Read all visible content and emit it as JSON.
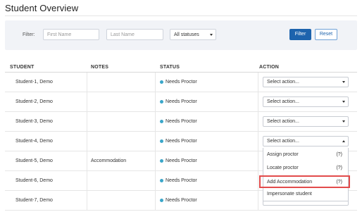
{
  "page": {
    "title": "Student Overview"
  },
  "filter": {
    "label": "Filter:",
    "first_name_placeholder": "First Name",
    "last_name_placeholder": "Last Name",
    "status_selected": "All statuses",
    "filter_button": "Filter",
    "reset_button": "Reset"
  },
  "table": {
    "headers": {
      "student": "STUDENT",
      "notes": "NOTES",
      "status": "STATUS",
      "action": "ACTION"
    },
    "rows": [
      {
        "student": "Student-1, Demo",
        "notes": "",
        "status": "Needs Proctor",
        "action": "Select action..."
      },
      {
        "student": "Student-2, Demo",
        "notes": "",
        "status": "Needs Proctor",
        "action": "Select action..."
      },
      {
        "student": "Student-3, Demo",
        "notes": "",
        "status": "Needs Proctor",
        "action": "Select action..."
      },
      {
        "student": "Student-4, Demo",
        "notes": "",
        "status": "Needs Proctor",
        "action": "Select action..."
      },
      {
        "student": "Student-5, Demo",
        "notes": "Accommodation",
        "status": "Needs Proctor",
        "action": ""
      },
      {
        "student": "Student-6, Demo",
        "notes": "",
        "status": "Needs Proctor",
        "action": ""
      },
      {
        "student": "Student-7, Demo",
        "notes": "",
        "status": "Needs Proctor",
        "action": "Select action..."
      }
    ]
  },
  "dropdown": {
    "items": [
      {
        "label": "Assign proctor",
        "help": "(?)"
      },
      {
        "label": "Locate proctor",
        "help": "(?)"
      },
      {
        "label": "Add Accommodation",
        "help": "(?)"
      },
      {
        "label": "Impersonate student",
        "help": ""
      }
    ]
  },
  "colors": {
    "status_dot": "#3aa6c9",
    "primary": "#1d63ad",
    "highlight": "#e24b4b"
  }
}
